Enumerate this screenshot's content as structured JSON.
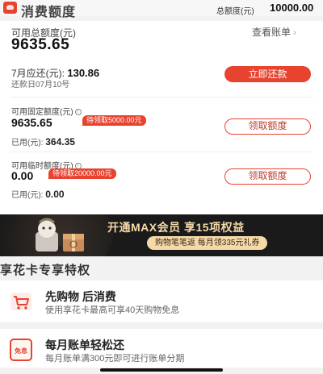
{
  "header": {
    "title": "消费额度",
    "total_label": "总额度(元)",
    "total_value": "10000.00"
  },
  "summary": {
    "available_label": "可用总额度(元)",
    "available_value": "9635.65",
    "view_bill_label": "查看账单",
    "due_label": "7月应还(元):",
    "due_value": "130.86",
    "due_date": "还款日07月10号",
    "repay_button": "立即还款"
  },
  "fixed_quota": {
    "label": "可用固定额度(元)",
    "value": "9635.65",
    "tag": "待领取5000.00元",
    "used_label": "已用(元):",
    "used_value": "364.35",
    "button": "领取额度"
  },
  "temp_quota": {
    "label": "可用临时额度(元)",
    "value": "0.00",
    "tag": "待领取20000.00元",
    "used_label": "已用(元):",
    "used_value": "0.00",
    "button": "领取额度"
  },
  "banner": {
    "title": "开通MAX会员 享15项权益",
    "subtitle": "购物笔笔返 每月领335元礼券"
  },
  "privileges": {
    "section_title": "享花卡专享特权",
    "items": [
      {
        "title": "先购物 后消费",
        "desc": "使用享花卡最高可享40天购物免息",
        "icon": "shopping-cart-icon"
      },
      {
        "title": "每月账单轻松还",
        "desc": "每月账单满300元即可进行账单分期",
        "icon": "interest-free-icon",
        "icon_text": "免息"
      }
    ]
  },
  "colors": {
    "accent": "#e8432f",
    "banner_bg": "#1a1a1a",
    "banner_gold": "#f6d9a8"
  }
}
